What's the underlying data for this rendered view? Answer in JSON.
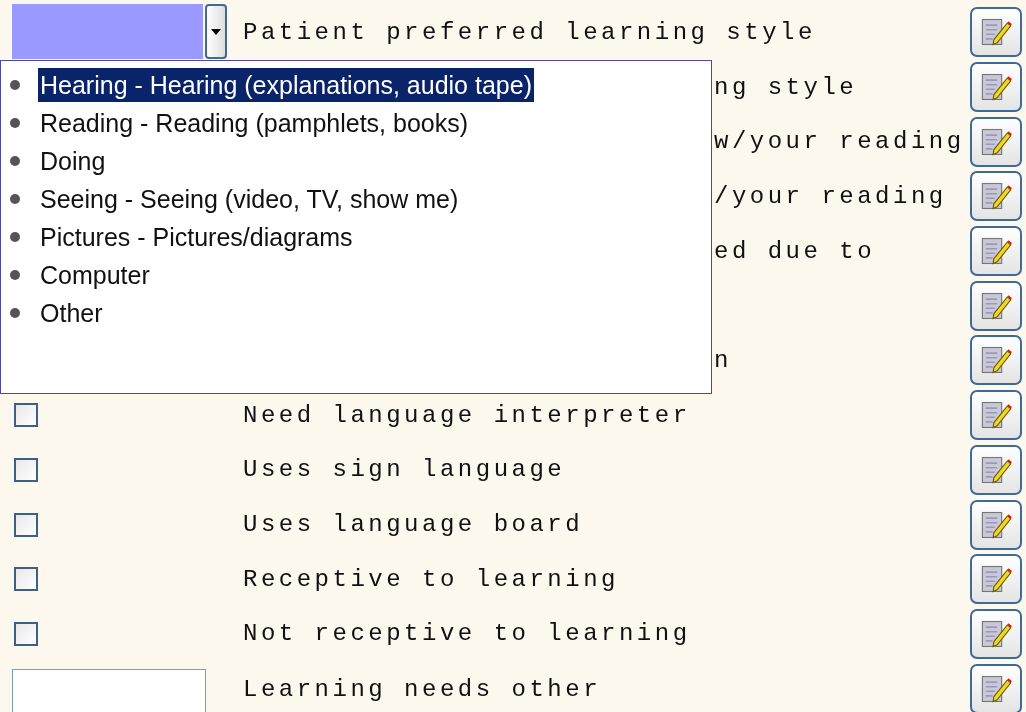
{
  "rows": [
    {
      "kind": "dropdown",
      "label": "Patient preferred learning style",
      "expanded": true,
      "options": [
        {
          "label": "Hearing - Hearing (explanations, audio tape)",
          "selected": true
        },
        {
          "label": "Reading - Reading (pamphlets, books)",
          "selected": false
        },
        {
          "label": "Doing",
          "selected": false
        },
        {
          "label": "Seeing - Seeing (video, TV, show me)",
          "selected": false
        },
        {
          "label": "Pictures - Pictures/diagrams",
          "selected": false
        },
        {
          "label": "Computer",
          "selected": false
        },
        {
          "label": "Other",
          "selected": false
        }
      ]
    },
    {
      "kind": "covered",
      "label": "ng style"
    },
    {
      "kind": "covered",
      "label": "w/your reading"
    },
    {
      "kind": "covered",
      "label": "/your reading"
    },
    {
      "kind": "covered",
      "label": "ed due to"
    },
    {
      "kind": "covered"
    },
    {
      "kind": "covered",
      "label": "n"
    },
    {
      "kind": "checkbox",
      "label": "Need language interpreter",
      "checked": false
    },
    {
      "kind": "checkbox",
      "label": "Uses sign language",
      "checked": false
    },
    {
      "kind": "checkbox",
      "label": "Uses language board",
      "checked": false
    },
    {
      "kind": "checkbox",
      "label": "Receptive to learning",
      "checked": false
    },
    {
      "kind": "checkbox",
      "label": "Not receptive to learning",
      "checked": false
    },
    {
      "kind": "text",
      "label": "Learning needs other"
    }
  ]
}
